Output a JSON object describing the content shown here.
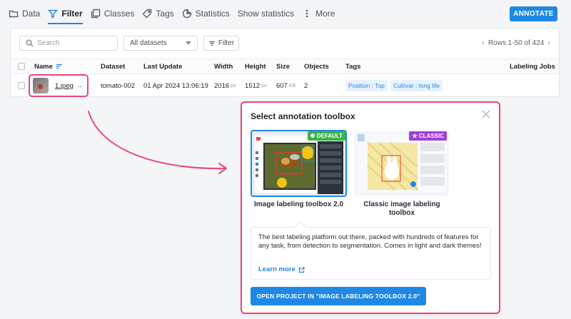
{
  "nav": {
    "items": [
      {
        "label": "Data",
        "icon": "folder-icon"
      },
      {
        "label": "Filter",
        "icon": "filter-icon",
        "active": true
      },
      {
        "label": "Classes",
        "icon": "classes-icon"
      },
      {
        "label": "Tags",
        "icon": "tag-icon"
      },
      {
        "label": "Statistics",
        "icon": "statistics-icon"
      },
      {
        "label": "Show statistics"
      },
      {
        "label": "More",
        "icon": "more-vertical-icon"
      }
    ],
    "annotate_label": "ANNOTATE"
  },
  "toolbar": {
    "search_placeholder": "Search",
    "dataset_select": "All datasets",
    "filter_label": "Filter",
    "rows_text": "Rows 1-50 of 424"
  },
  "table": {
    "headers": [
      "Name",
      "Dataset",
      "Last Update",
      "Width",
      "Height",
      "Size",
      "Objects",
      "Tags",
      "Labeling Jobs"
    ],
    "rows": [
      {
        "name": "1.jpeg",
        "dataset": "tomato-002",
        "last_update": "01 Apr 2024 13:06:19",
        "width": "2016",
        "width_unit": "px",
        "height": "1512",
        "height_unit": "px",
        "size": "607",
        "size_unit": "KB",
        "objects": "2",
        "tags": [
          "Position : Top",
          "Cultivar : long life"
        ]
      }
    ]
  },
  "dialog": {
    "title": "Select annotation toolbox",
    "option1": {
      "label": "Image labeling toolbox 2.0",
      "badge": "DEFAULT",
      "selected": true
    },
    "option2": {
      "label": "Classic image labeling toolbox",
      "badge": "CLASSIC"
    },
    "description": "The best labeling platform out there, packed with hundreds of features for any task, from detection to segmentation. Comes in light and dark themes!",
    "learn_more": "Learn more",
    "open_button": "OPEN PROJECT IN \"IMAGE LABELING TOOLBOX 2.0\""
  },
  "colors": {
    "accent": "#1e88e5",
    "highlight": "#e8467c",
    "default_badge": "#3bb34a",
    "classic_badge": "#a23fd8"
  }
}
